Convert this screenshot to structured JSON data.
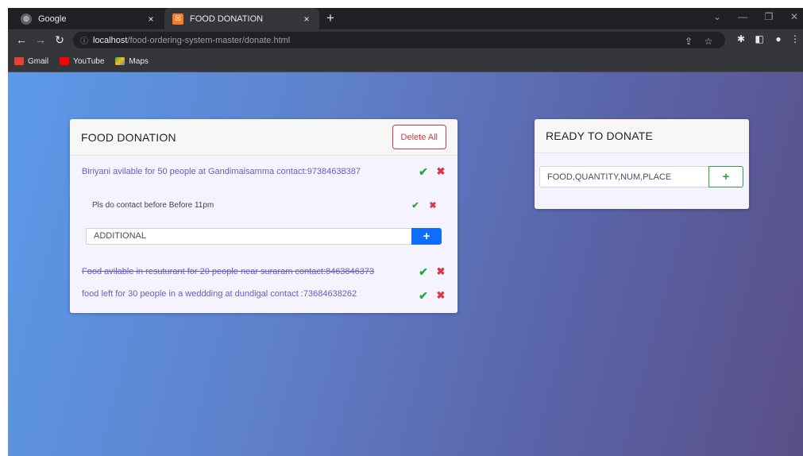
{
  "browser": {
    "tabs": [
      {
        "title": "Google",
        "icon": "globe-icon",
        "active": false
      },
      {
        "title": "FOOD DONATION",
        "icon": "xampp-icon",
        "active": true
      }
    ],
    "close_glyph": "×",
    "new_tab_glyph": "+",
    "url_host": "localhost",
    "url_path": "/food-ordering-system-master/donate.html",
    "bookmarks": [
      {
        "label": "Gmail",
        "icon": "gmail-icon",
        "color": "#ea4335"
      },
      {
        "label": "YouTube",
        "icon": "youtube-icon",
        "color": "#ff0000"
      },
      {
        "label": "Maps",
        "icon": "maps-icon",
        "color": "#34a853"
      }
    ]
  },
  "donation_card": {
    "title": "FOOD DONATION",
    "delete_all_label": "Delete All",
    "items": [
      {
        "text": "Biriyani avilable for 50 people at Gandimaisamma contact:97384638387",
        "done": false
      },
      {
        "text": "Pls do contact before Before 11pm",
        "done": false,
        "sub": true
      },
      {
        "text": "Food avilable in resuturant for 20 people near suraram contact:8463846373",
        "done": true
      },
      {
        "text": "food left for 30 people in a weddding at dundigal contact :73684638262",
        "done": false
      }
    ],
    "additional_placeholder": "ADDITIONAL",
    "check_glyph": "✔",
    "delete_glyph": "✖",
    "plus_glyph": "+"
  },
  "ready_card": {
    "title": "READY TO DONATE",
    "input_placeholder": "FOOD,QUANTITY,NUM,PLACE",
    "plus_glyph": "+"
  },
  "colors": {
    "accent_blue": "#0d6efd",
    "success": "#29a745",
    "danger": "#dc3545",
    "item_text": "#6a5ccd"
  }
}
